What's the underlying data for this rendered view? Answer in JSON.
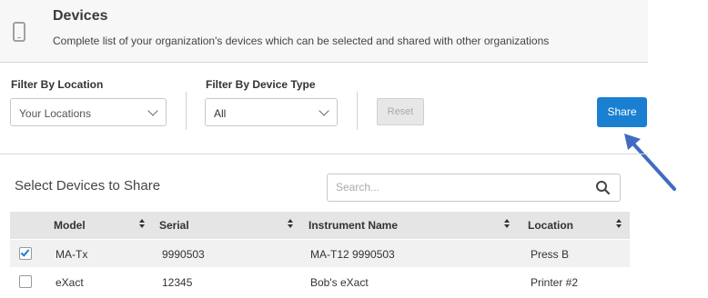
{
  "header": {
    "title": "Devices",
    "subtitle": "Complete list of your organization's devices which can be selected and shared with other organizations",
    "icon": "mobile-device-icon"
  },
  "filters": {
    "location_label": "Filter By Location",
    "location_value": "Your Locations",
    "type_label": "Filter By Device Type",
    "type_value": "All",
    "reset_label": "Reset",
    "share_label": "Share"
  },
  "section": {
    "title": "Select Devices to Share",
    "search_placeholder": "Search..."
  },
  "table": {
    "columns": [
      "Model",
      "Serial",
      "Instrument Name",
      "Location"
    ],
    "rows": [
      {
        "checked": true,
        "model": "MA-Tx",
        "serial": "9990503",
        "instrument_name": "MA-T12 9990503",
        "location": "Press B"
      },
      {
        "checked": false,
        "model": "eXact",
        "serial": "12345",
        "instrument_name": "Bob's eXact",
        "location": "Printer #2"
      }
    ]
  },
  "colors": {
    "accent": "#1a7fd0",
    "arrow": "#3f6cc0",
    "header_bg": "#f7f7f7",
    "table_header_bg": "#e5e5e5"
  }
}
